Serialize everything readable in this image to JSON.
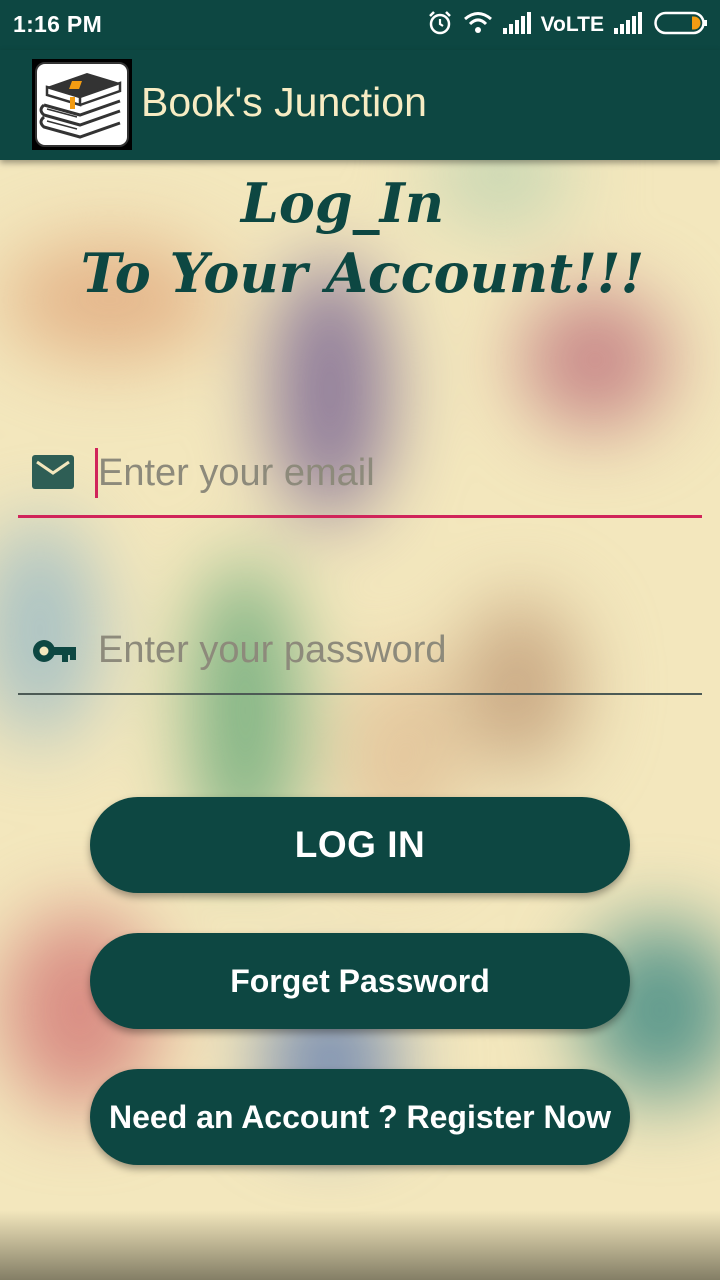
{
  "status_bar": {
    "time": "1:16 PM",
    "network_label": "VoLTE",
    "icons": [
      "alarm-icon",
      "wifi-icon",
      "signal-icon",
      "signal-icon",
      "battery-icon"
    ]
  },
  "app_bar": {
    "title": "Book's Junction",
    "logo_icon": "books-stack-icon"
  },
  "heading": {
    "line1": "Log_In",
    "line2": "To Your Account!!!"
  },
  "form": {
    "email": {
      "placeholder": "Enter your email",
      "value": "",
      "icon": "envelope-icon"
    },
    "password": {
      "placeholder": "Enter your password",
      "value": "",
      "icon": "key-icon"
    }
  },
  "buttons": {
    "login": "LOG IN",
    "forget_password": "Forget Password",
    "register": "Need an Account ? Register Now"
  },
  "colors": {
    "primary": "#0d4742",
    "accent": "#d0245a",
    "title_text": "#f7ecc3",
    "background": "#f3e7bd",
    "battery_fill": "#f39c12"
  }
}
